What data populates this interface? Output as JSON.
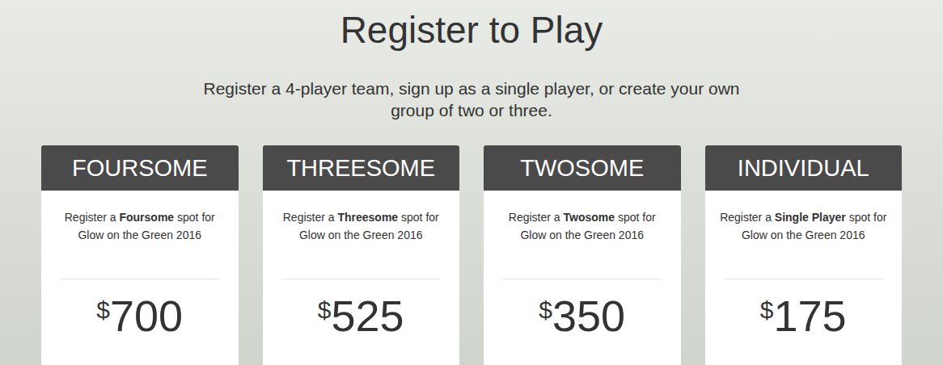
{
  "heading": {
    "title": "Register to Play",
    "subtitle": "Register a 4-player team, sign up as a single player, or create your own group of two or three."
  },
  "cards": [
    {
      "header": "FOURSOME",
      "before": "Register a ",
      "bold": "Foursome",
      "after": " spot for Glow on the Green 2016",
      "currency": "$",
      "price": "700"
    },
    {
      "header": "THREESOME",
      "before": "Register a ",
      "bold": "Threesome",
      "after": " spot for Glow on the Green 2016",
      "currency": "$",
      "price": "525"
    },
    {
      "header": "TWOSOME",
      "before": "Register a ",
      "bold": "Twosome",
      "after": " spot for Glow on the Green 2016",
      "currency": "$",
      "price": "350"
    },
    {
      "header": "INDIVIDUAL",
      "before": "Register a ",
      "bold": "Single Player",
      "after": " spot for Glow on the Green 2016",
      "currency": "$",
      "price": "175"
    }
  ]
}
